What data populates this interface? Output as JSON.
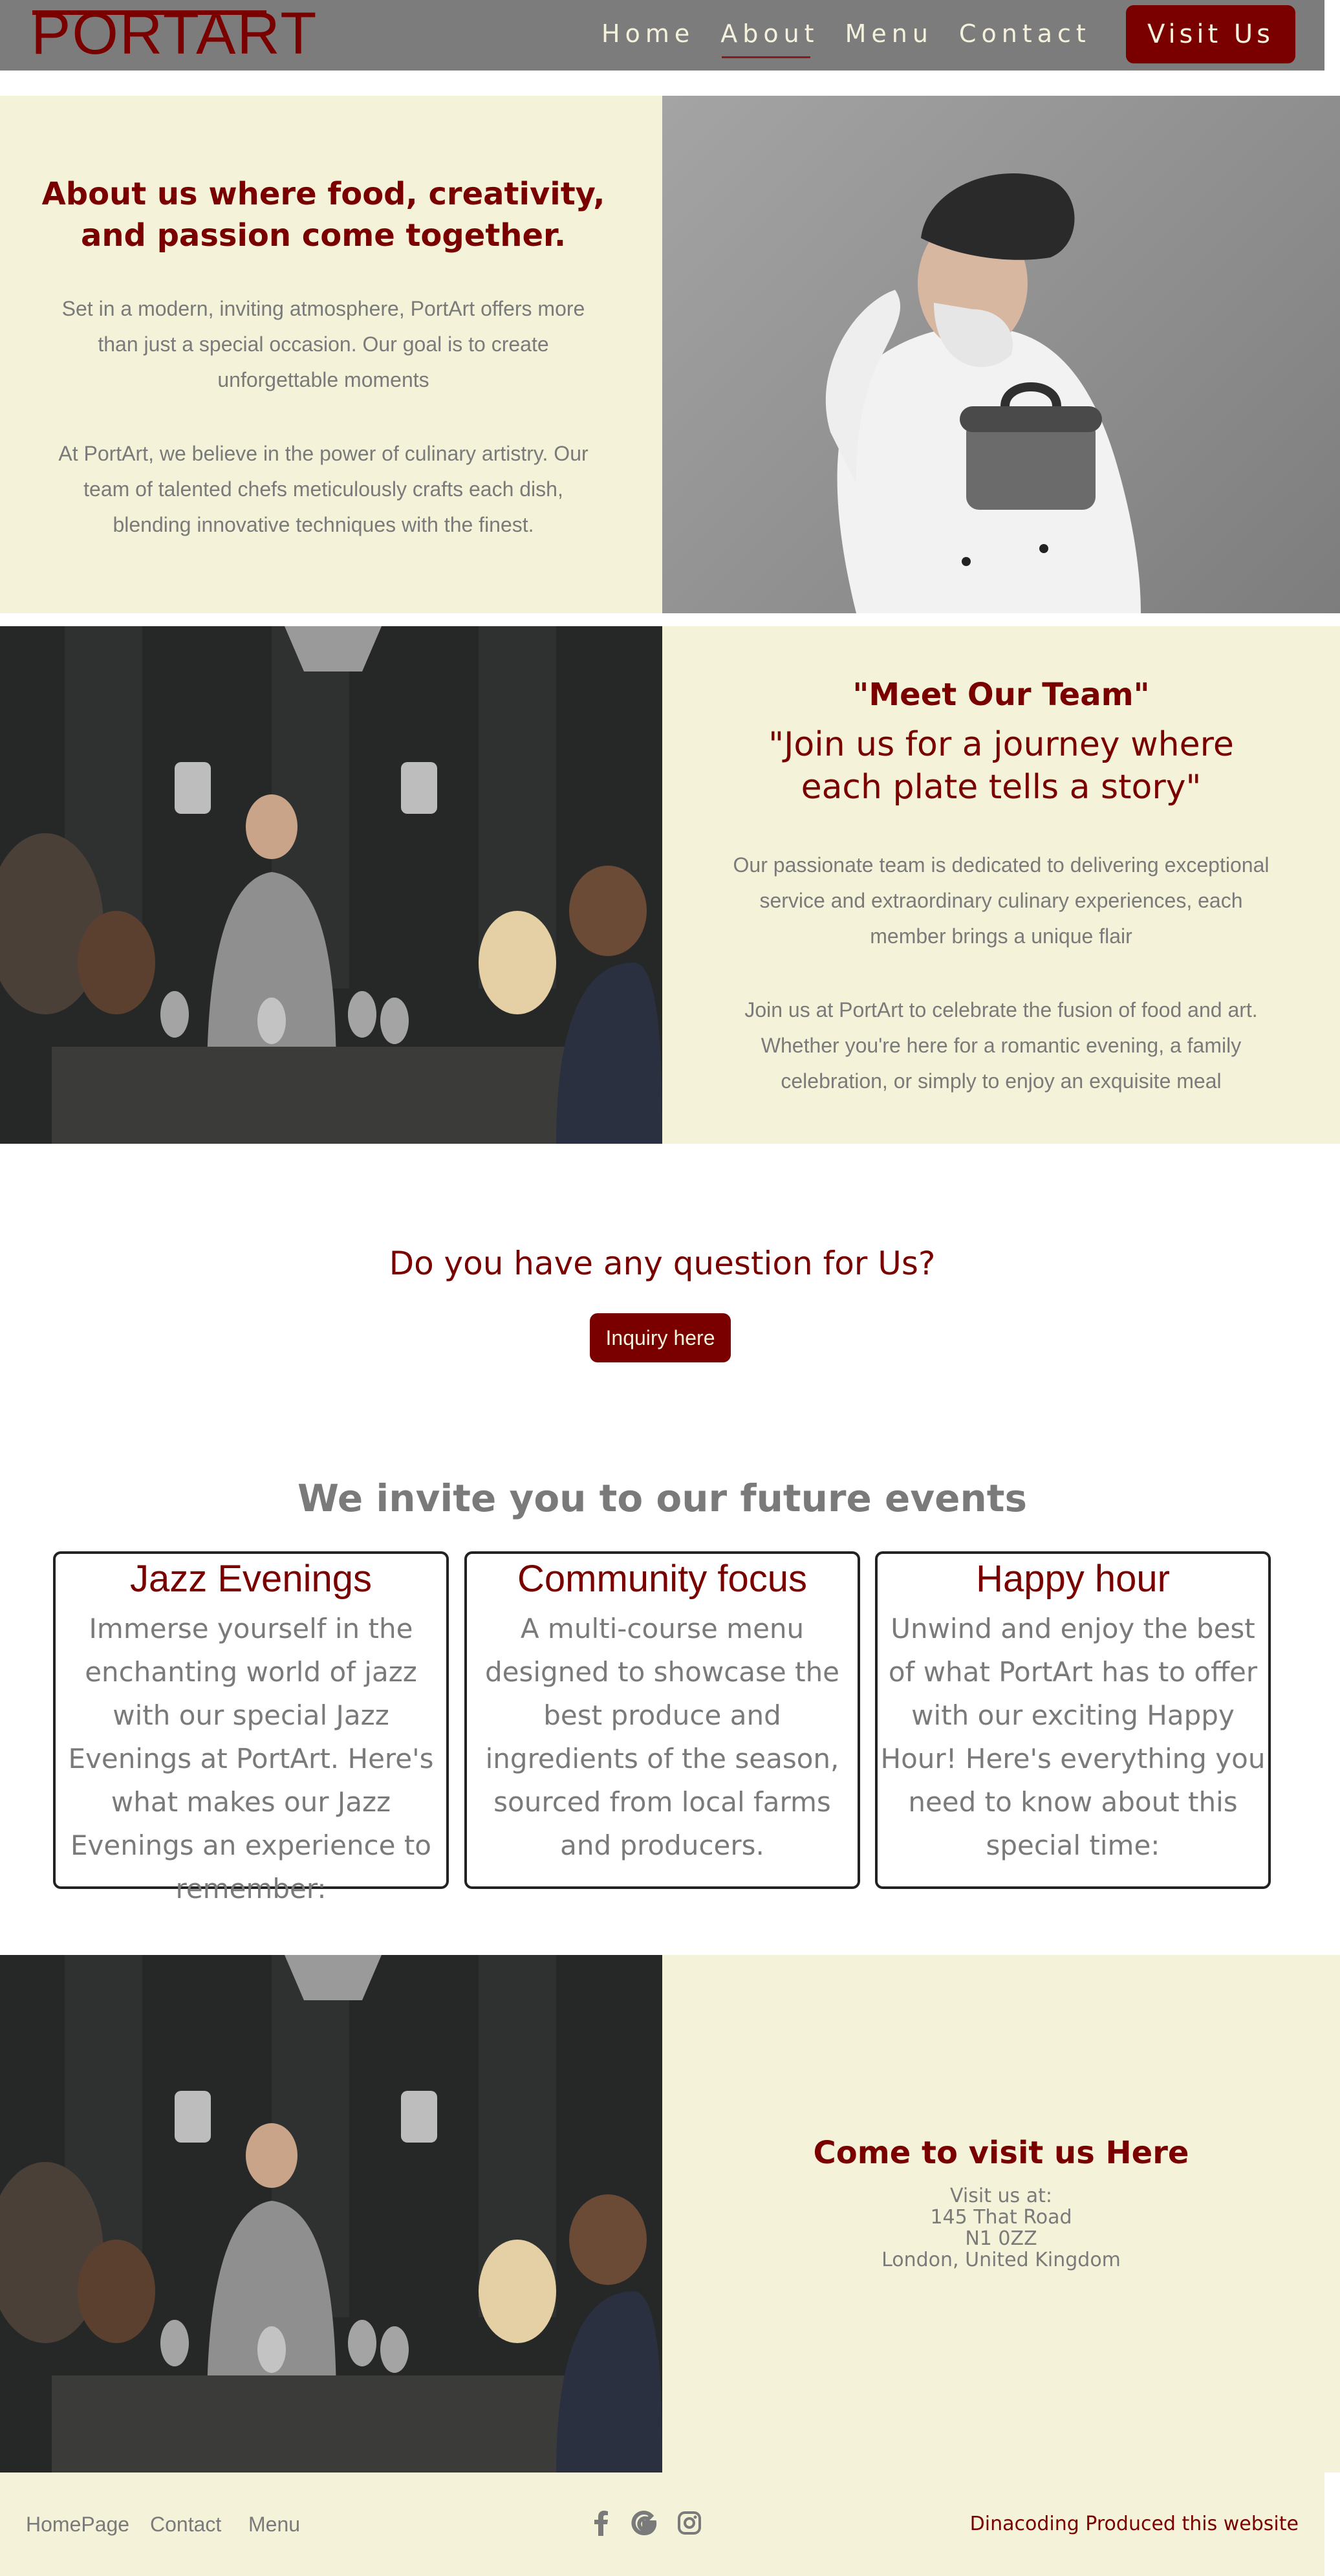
{
  "nav": {
    "logo": "PORTART",
    "links": [
      "Home",
      "About",
      "Menu",
      "Contact"
    ],
    "active_link": "About",
    "cta": "Visit Us"
  },
  "about": {
    "title": "About us where food, creativity, and passion come together.",
    "para1": "Set in a modern, inviting atmosphere, PortArt offers more than just a special occasion. Our goal is to create unforgettable moments",
    "para2": "At PortArt, we believe in the power of culinary artistry. Our team of talented chefs meticulously crafts each dish, blending innovative techniques with the finest."
  },
  "team": {
    "title": "\"Meet Our Team\"",
    "subtitle": "\"Join us for a journey where each plate tells a story\"",
    "para1": "Our passionate team is dedicated to delivering exceptional service and extraordinary culinary experiences, each member brings a unique flair",
    "para2": "Join us at PortArt to celebrate the fusion of food and art. Whether you're here for a romantic evening, a family celebration, or simply to enjoy an exquisite meal"
  },
  "inquiry": {
    "question": "Do you have any question for Us?",
    "button": "Inquiry here"
  },
  "events": {
    "title": "We invite you to our future events",
    "cards": [
      {
        "title": "Jazz Evenings",
        "text": "Immerse yourself in the enchanting world of jazz with our special Jazz Evenings at PortArt. Here's what makes our Jazz Evenings an experience to remember:"
      },
      {
        "title": "Community focus",
        "text": "A multi-course menu designed to showcase the best produce and ingredients of the season, sourced from local farms and producers."
      },
      {
        "title": "Happy hour",
        "text": "Unwind and enjoy the best of what PortArt has to offer with our exciting Happy Hour! Here's everything you need to know about this special time:"
      }
    ]
  },
  "visit": {
    "title": "Come to visit us Here",
    "lines": [
      "Visit us at:",
      "145 That Road",
      "N1 0ZZ",
      "London, United Kingdom"
    ]
  },
  "footer": {
    "links": [
      "HomePage",
      "Contact",
      "Menu"
    ],
    "icons": [
      "facebook-icon",
      "google-icon",
      "instagram-icon"
    ],
    "credit": "Dinacoding Produced this website"
  },
  "colors": {
    "brand": "#7a0000",
    "cream": "#f4f3d9",
    "nav": "#7c7c7c",
    "text": "#7a7a7a"
  }
}
